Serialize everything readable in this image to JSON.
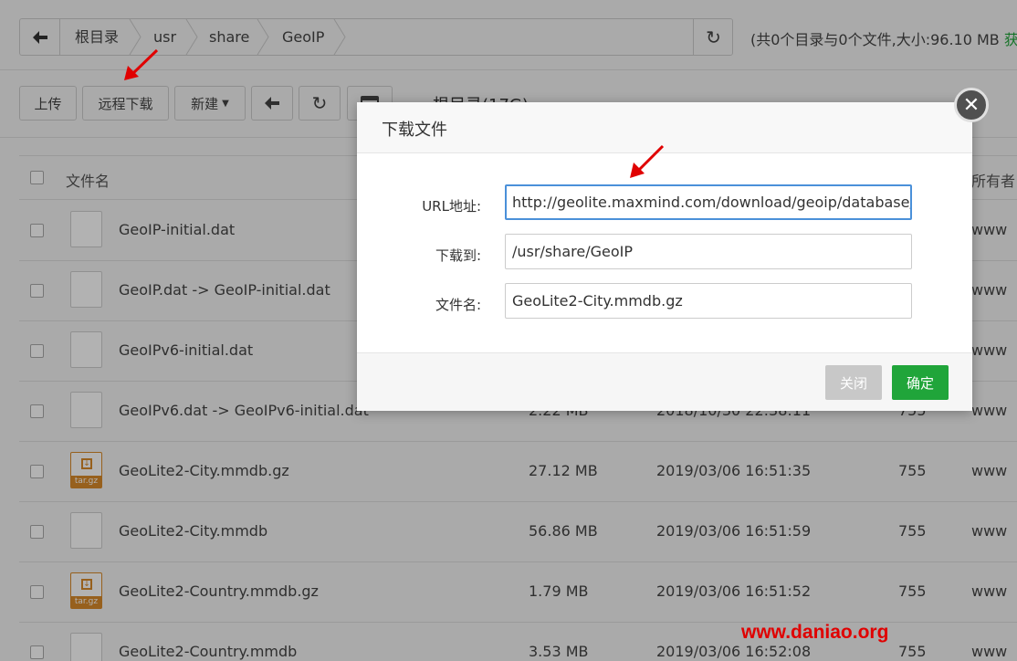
{
  "breadcrumb": {
    "items": [
      "根目录",
      "usr",
      "share",
      "GeoIP"
    ],
    "summary_prefix": "(共0个目录与0个文件,大小:96.10 MB ",
    "summary_suffix": "获取"
  },
  "toolbar": {
    "upload": "上传",
    "remote_download": "远程下载",
    "new": "新建",
    "root_label": "根目录(17G)"
  },
  "table": {
    "headers": {
      "name": "文件名",
      "owner": "所有者"
    },
    "rows": [
      {
        "name": "GeoIP-initial.dat",
        "size": "",
        "time": "",
        "perm": "",
        "owner": "www",
        "type": "file"
      },
      {
        "name": "GeoIP.dat -> GeoIP-initial.dat",
        "size": "",
        "time": "",
        "perm": "",
        "owner": "www",
        "type": "file"
      },
      {
        "name": "GeoIPv6-initial.dat",
        "size": "",
        "time": "",
        "perm": "",
        "owner": "www",
        "type": "file"
      },
      {
        "name": "GeoIPv6.dat -> GeoIPv6-initial.dat",
        "size": "2.22 MB",
        "time": "2018/10/30 22:38:11",
        "perm": "755",
        "owner": "www",
        "type": "file"
      },
      {
        "name": "GeoLite2-City.mmdb.gz",
        "size": "27.12 MB",
        "time": "2019/03/06 16:51:35",
        "perm": "755",
        "owner": "www",
        "type": "tar"
      },
      {
        "name": "GeoLite2-City.mmdb",
        "size": "56.86 MB",
        "time": "2019/03/06 16:51:59",
        "perm": "755",
        "owner": "www",
        "type": "file"
      },
      {
        "name": "GeoLite2-Country.mmdb.gz",
        "size": "1.79 MB",
        "time": "2019/03/06 16:51:52",
        "perm": "755",
        "owner": "www",
        "type": "tar"
      },
      {
        "name": "GeoLite2-Country.mmdb",
        "size": "3.53 MB",
        "time": "2019/03/06 16:52:08",
        "perm": "755",
        "owner": "www",
        "type": "file"
      }
    ],
    "tar_badge": "tar.gz"
  },
  "modal": {
    "title": "下载文件",
    "url_label": "URL地址:",
    "url_value": "http://geolite.maxmind.com/download/geoip/database/",
    "dest_label": "下载到:",
    "dest_value": "/usr/share/GeoIP",
    "filename_label": "文件名:",
    "filename_value": "GeoLite2-City.mmdb.gz",
    "close_label": "关闭",
    "confirm_label": "确定"
  },
  "watermark": "www.daniao.org",
  "colors": {
    "accent_green": "#20a53a",
    "arrow_red": "#e00000"
  }
}
